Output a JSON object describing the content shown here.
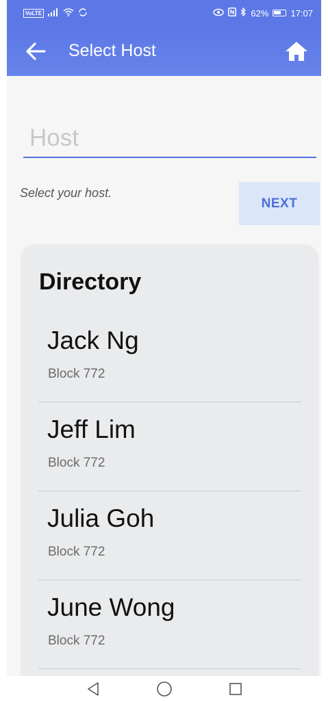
{
  "status_bar": {
    "network_label": "VoLTE",
    "battery_percent": "62%",
    "time": "17:07",
    "icons": [
      "volte-icon",
      "signal-icon",
      "wifi-icon",
      "sync-icon",
      "eye-icon",
      "nfc-icon",
      "bluetooth-icon",
      "battery-icon"
    ]
  },
  "app_bar": {
    "title": "Select Host",
    "back_icon": "arrow-left-icon",
    "home_icon": "home-icon"
  },
  "form": {
    "host_placeholder": "Host",
    "host_value": "",
    "helper_text": "Select your host.",
    "next_label": "NEXT"
  },
  "directory": {
    "title": "Directory",
    "entries": [
      {
        "name": "Jack Ng",
        "subtitle": "Block 772"
      },
      {
        "name": "Jeff Lim",
        "subtitle": "Block 772"
      },
      {
        "name": "Julia Goh",
        "subtitle": "Block 772"
      },
      {
        "name": "June Wong",
        "subtitle": "Block 772"
      }
    ]
  },
  "nav_bar": {
    "icons": [
      "back-triangle-icon",
      "home-circle-icon",
      "recents-square-icon"
    ]
  },
  "colors": {
    "primary": "#5c78e6",
    "accent": "#4a6fd8",
    "next_bg": "#dbe6f8",
    "card_bg": "#e9ebed"
  }
}
